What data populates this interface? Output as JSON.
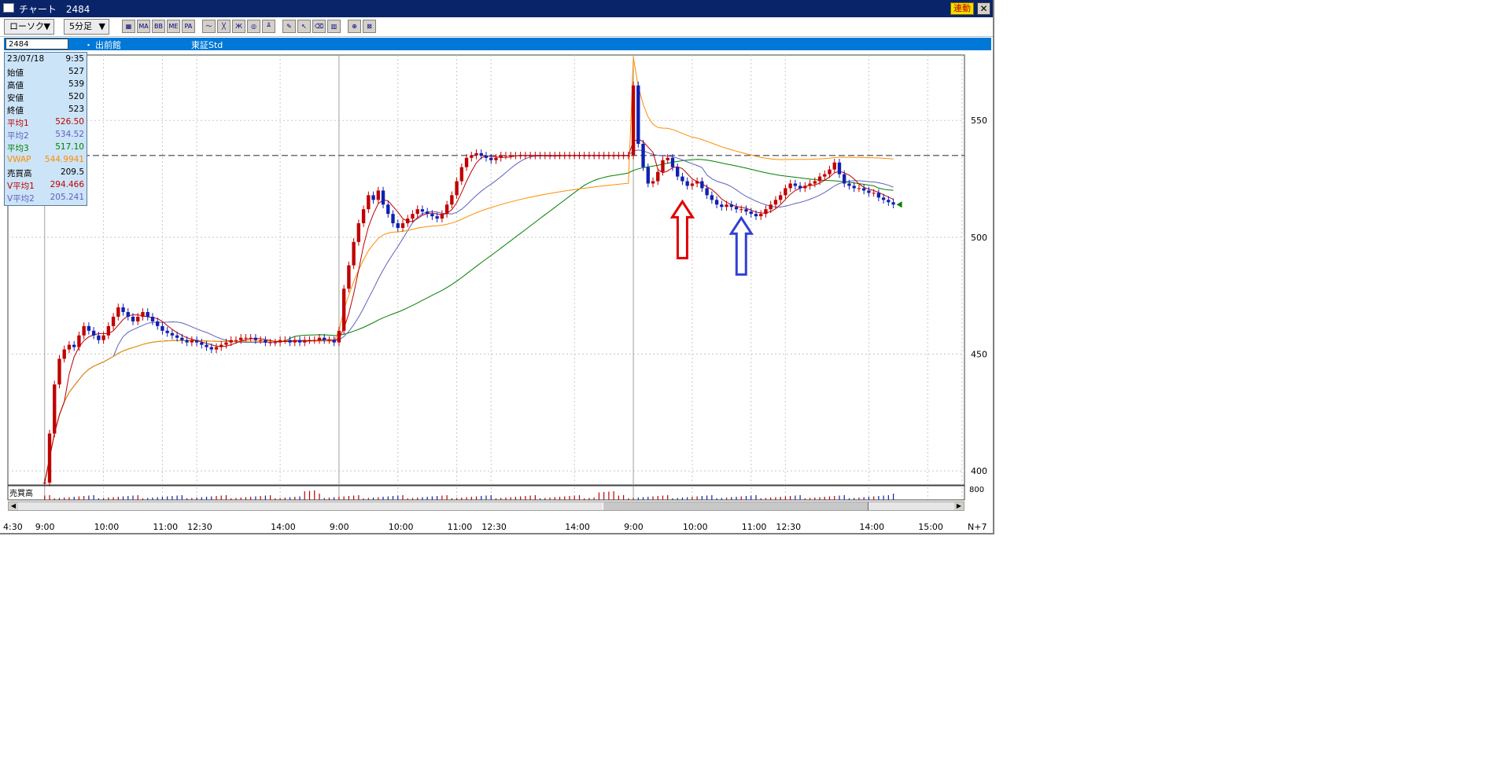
{
  "window": {
    "title": "チャート　2484",
    "link_label": "連動",
    "close_label": "✕"
  },
  "toolbar": {
    "chart_type": "ローソク",
    "interval": "5分足",
    "icons": [
      {
        "name": "candle-settings-icon",
        "glyph": "▦"
      },
      {
        "name": "ma-icon",
        "glyph": "MA"
      },
      {
        "name": "bb-icon",
        "glyph": "BB"
      },
      {
        "name": "me-icon",
        "glyph": "ME"
      },
      {
        "name": "pa-icon",
        "glyph": "PA"
      },
      {
        "name": "line-icon",
        "glyph": "〜"
      },
      {
        "name": "cross-line-icon",
        "glyph": "╳"
      },
      {
        "name": "zigzag-icon",
        "glyph": "Ж"
      },
      {
        "name": "zoom-icon",
        "glyph": "◎"
      },
      {
        "name": "period-icon",
        "glyph": "╨"
      },
      {
        "name": "pencil-icon",
        "glyph": "✎"
      },
      {
        "name": "cursor-icon",
        "glyph": "↖"
      },
      {
        "name": "eraser-icon",
        "glyph": "⌫"
      },
      {
        "name": "trash-icon",
        "glyph": "▥"
      },
      {
        "name": "magnify-icon",
        "glyph": "⊕"
      },
      {
        "name": "reset-icon",
        "glyph": "⊠"
      }
    ]
  },
  "infobar": {
    "code": "2484",
    "dot": "・",
    "name": "出前館",
    "market": "東証Std"
  },
  "ohlc": {
    "datetime_date": "23/07/18",
    "datetime_time": "9:35",
    "rows": [
      {
        "label": "始値",
        "value": "527",
        "color": "#000000"
      },
      {
        "label": "高値",
        "value": "539",
        "color": "#000000"
      },
      {
        "label": "安値",
        "value": "520",
        "color": "#000000"
      },
      {
        "label": "終値",
        "value": "523",
        "color": "#000000"
      },
      {
        "label": "平均1",
        "value": "526.50",
        "color": "#c00000"
      },
      {
        "label": "平均2",
        "value": "534.52",
        "color": "#6060c0"
      },
      {
        "label": "平均3",
        "value": "517.10",
        "color": "#008000"
      },
      {
        "label": "VWAP",
        "value": "544.9941",
        "color": "#ff8c00"
      },
      {
        "label": "売買高",
        "value": "209.5",
        "color": "#000000"
      },
      {
        "label": "V平均1",
        "value": "294.466",
        "color": "#c00000"
      },
      {
        "label": "V平均2",
        "value": "205.241",
        "color": "#6060c0"
      }
    ]
  },
  "colors": {
    "up": "#c00000",
    "down": "#1020b0",
    "ma1": "#c00000",
    "ma2": "#6060c0",
    "ma3": "#008000",
    "vwap": "#ff8c00",
    "up_arrow_red": "#e00000",
    "up_arrow_blue": "#3040d0"
  },
  "volume_label": "売買高",
  "chart_data": {
    "type": "candlestick",
    "y_ticks": [
      400,
      450,
      500,
      550
    ],
    "ylim": [
      394,
      578
    ],
    "volume_tick": "800",
    "dashed_level": 535,
    "x_tick_labels": [
      "4:30",
      "9:00",
      "10:00",
      "11:00",
      "12:30",
      "14:00",
      "9:00",
      "10:00",
      "11:00",
      "12:30",
      "14:00",
      "9:00",
      "10:00",
      "11:00",
      "12:30",
      "14:00",
      "15:00",
      "N+7"
    ],
    "total_bars": 195,
    "session_starts": [
      7,
      67,
      127
    ],
    "sessions": [
      {
        "x_ticks": [
          7,
          19,
          31,
          38,
          55
        ],
        "closes": [
          395,
          416,
          437,
          448,
          452,
          454,
          453,
          458,
          462,
          460,
          458,
          456,
          458,
          462,
          466,
          470,
          468,
          466,
          464,
          466,
          468,
          466,
          464,
          462,
          460,
          459,
          458,
          457,
          456,
          455,
          456,
          455,
          454,
          453,
          452,
          453,
          454,
          455,
          456,
          456,
          457,
          457,
          457,
          456,
          456,
          455,
          455,
          455,
          456,
          456,
          455,
          456,
          455,
          456,
          456,
          456,
          457,
          456,
          456,
          455
        ]
      },
      {
        "x_ticks": [
          67,
          79,
          91,
          98,
          115
        ],
        "closes": [
          460,
          478,
          488,
          498,
          506,
          512,
          518,
          516,
          520,
          514,
          510,
          506,
          504,
          506,
          508,
          510,
          512,
          511,
          510,
          509,
          508,
          510,
          514,
          518,
          524,
          530,
          534,
          535,
          536,
          535,
          534,
          533,
          534,
          535,
          535,
          535,
          535,
          535,
          535,
          535,
          535,
          535,
          535,
          535,
          535,
          535,
          535,
          535,
          535,
          535,
          535,
          535,
          535,
          535,
          535,
          535,
          535,
          535,
          535,
          535
        ]
      },
      {
        "x_ticks": [
          127,
          139,
          151,
          158,
          175,
          187,
          194
        ],
        "closes": [
          565,
          540,
          530,
          523,
          524,
          528,
          533,
          534,
          530,
          526,
          524,
          522,
          523,
          524,
          521,
          518,
          516,
          514,
          513,
          514,
          513,
          512,
          512,
          511,
          510,
          509,
          510,
          512,
          514,
          516,
          518,
          521,
          523,
          522,
          521,
          522,
          523,
          524,
          526,
          527,
          529,
          532,
          527,
          523,
          522,
          521,
          521,
          520,
          519,
          519,
          517,
          516,
          515,
          514
        ]
      }
    ]
  }
}
